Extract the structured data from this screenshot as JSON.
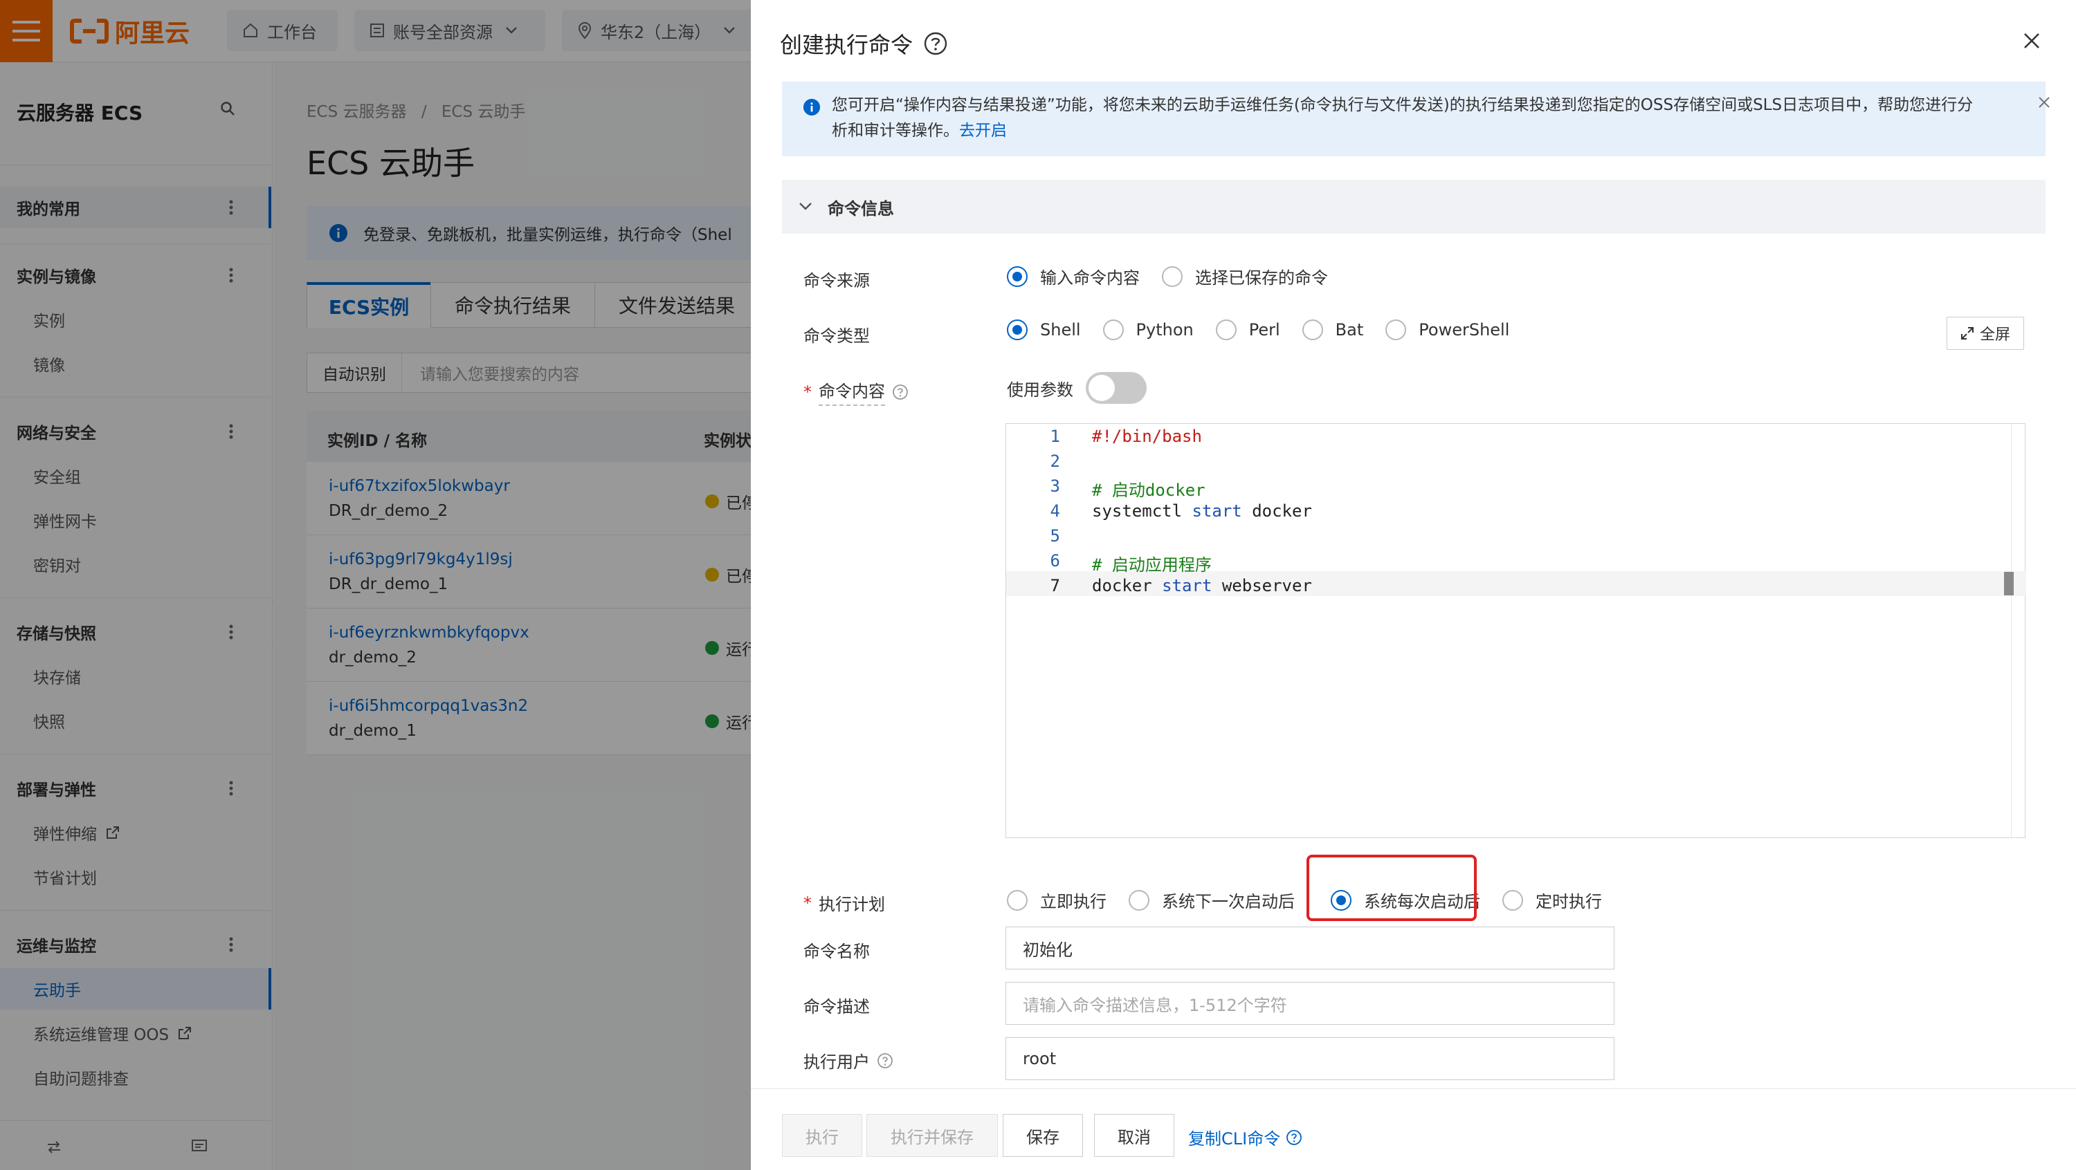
{
  "brand": {
    "name": "阿里云",
    "color": "#ff6a00"
  },
  "topbar": {
    "workbench": "工作台",
    "resources": "账号全部资源",
    "region": "华东2（上海）"
  },
  "sidebar": {
    "title": "云服务器 ECS",
    "groups": [
      {
        "label": "我的常用",
        "items": []
      },
      {
        "label": "实例与镜像",
        "items": [
          "实例",
          "镜像"
        ]
      },
      {
        "label": "网络与安全",
        "items": [
          "安全组",
          "弹性网卡",
          "密钥对"
        ]
      },
      {
        "label": "存储与快照",
        "items": [
          "块存储",
          "快照"
        ]
      },
      {
        "label": "部署与弹性",
        "items": [
          "弹性伸缩",
          "节省计划"
        ]
      },
      {
        "label": "运维与监控",
        "items": [
          "云助手",
          "系统运维管理 OOS",
          "自助问题排查"
        ]
      }
    ],
    "active_item": "云助手"
  },
  "main": {
    "breadcrumb": [
      "ECS 云服务器",
      "ECS 云助手"
    ],
    "breadcrumb_sep": "/",
    "title": "ECS 云助手",
    "notice": "免登录、免跳板机，批量实例运维，执行命令（Shel",
    "tabs": [
      "ECS实例",
      "命令执行结果",
      "文件发送结果"
    ],
    "search_scope": "自动识别",
    "search_placeholder": "请输入您要搜索的内容",
    "table": {
      "columns": [
        "实例ID / 名称",
        "实例状"
      ],
      "rows": [
        {
          "id": "i-uf67txzifox5lokwbayr",
          "name": "DR_dr_demo_2",
          "status": "已停",
          "status_color": "#e8b400"
        },
        {
          "id": "i-uf63pg9rl79kg4y1l9sj",
          "name": "DR_dr_demo_1",
          "status": "已停",
          "status_color": "#e8b400"
        },
        {
          "id": "i-uf6eyrznkwmbkyfqopvx",
          "name": "dr_demo_2",
          "status": "运行",
          "status_color": "#1e9e3e"
        },
        {
          "id": "i-uf6i5hmcorpqq1vas3n2",
          "name": "dr_demo_1",
          "status": "运行",
          "status_color": "#1e9e3e"
        }
      ]
    }
  },
  "drawer": {
    "title": "创建执行命令",
    "info_text": "您可开启“操作内容与结果投递”功能，将您未来的云助手运维任务(命令执行与文件发送)的执行结果投递到您指定的OSS存储空间或SLS日志项目中，帮助您进行分析和审计等操作。",
    "info_link": "去开启",
    "section": "命令信息",
    "fields": {
      "source": {
        "label": "命令来源",
        "options": [
          "输入命令内容",
          "选择已保存的命令"
        ],
        "selected": "输入命令内容"
      },
      "type": {
        "label": "命令类型",
        "options": [
          "Shell",
          "Python",
          "Perl",
          "Bat",
          "PowerShell"
        ],
        "selected": "Shell"
      },
      "fullscreen": "全屏",
      "content": {
        "label": "命令内容",
        "use_params_label": "使用参数",
        "use_params": false
      },
      "code_lines": [
        {
          "n": "1",
          "text": "#!/bin/bash"
        },
        {
          "n": "2",
          "text": ""
        },
        {
          "n": "3",
          "text": "# 启动docker"
        },
        {
          "n": "4",
          "text": "systemctl start docker"
        },
        {
          "n": "5",
          "text": ""
        },
        {
          "n": "6",
          "text": "# 启动应用程序"
        },
        {
          "n": "7",
          "text": "docker start webserver"
        }
      ],
      "plan": {
        "label": "执行计划",
        "options": [
          "立即执行",
          "系统下一次启动后",
          "系统每次启动后",
          "定时执行"
        ],
        "selected": "系统每次启动后"
      },
      "name": {
        "label": "命令名称",
        "value": "初始化"
      },
      "desc": {
        "label": "命令描述",
        "placeholder": "请输入命令描述信息，1-512个字符"
      },
      "user": {
        "label": "执行用户",
        "value": "root"
      }
    },
    "footer": {
      "run": "执行",
      "run_save": "执行并保存",
      "save": "保存",
      "cancel": "取消",
      "copy_cli": "复制CLI命令"
    }
  },
  "colors": {
    "accent": "#0064c8",
    "highlight": "#e02020"
  }
}
